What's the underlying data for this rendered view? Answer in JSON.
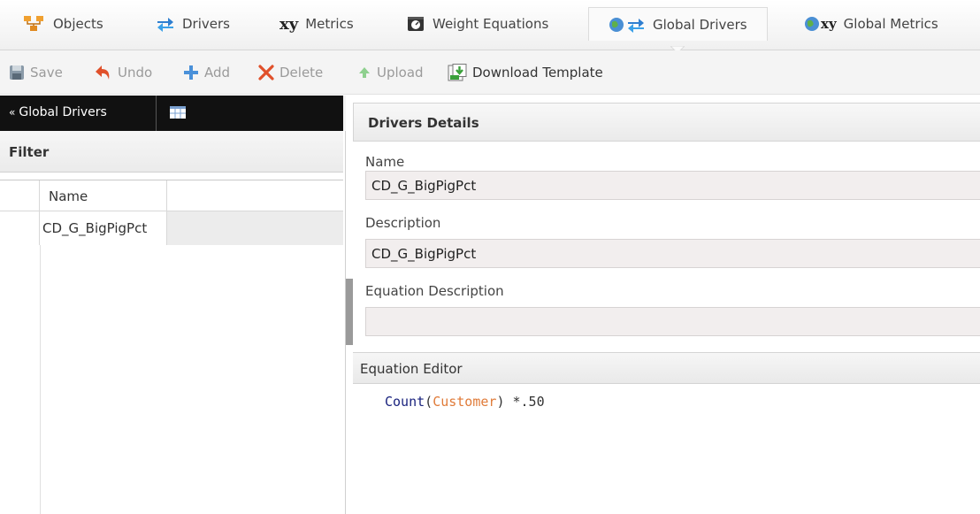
{
  "tabs": [
    {
      "label": "Objects",
      "icon": "objects-icon"
    },
    {
      "label": "Drivers",
      "icon": "drivers-icon"
    },
    {
      "label": "Metrics",
      "icon": "xy-metrics-icon",
      "icon_text": "xy"
    },
    {
      "label": "Weight Equations",
      "icon": "scale-icon"
    },
    {
      "label": "Global Drivers",
      "icon": "globe-drivers-icon",
      "active": true
    },
    {
      "label": "Global Metrics",
      "icon": "globe-xy-icon",
      "icon_text": "xy"
    }
  ],
  "toolbar": {
    "save": "Save",
    "undo": "Undo",
    "add": "Add",
    "delete": "Delete",
    "upload": "Upload",
    "download": "Download Template"
  },
  "left_panel": {
    "title": "Global Drivers",
    "filter_label": "Filter",
    "grid": {
      "columns": [
        "Name"
      ],
      "rows": [
        [
          "CD_G_BigPigPct"
        ]
      ]
    }
  },
  "details": {
    "header": "Drivers Details",
    "name_label": "Name",
    "name_value": "CD_G_BigPigPct",
    "description_label": "Description",
    "description_value": "CD_G_BigPigPct",
    "equation_description_label": "Equation Description",
    "equation_description_value": ""
  },
  "equation_editor": {
    "header": "Equation Editor",
    "function": "Count",
    "open_paren": "(",
    "argument": "Customer",
    "close_paren": ")",
    "operator": " *",
    "number": ".50"
  },
  "colors": {
    "tab_active_bg": "#fafafa",
    "left_header_bg": "#111111",
    "field_bg": "#f2eeee",
    "code_function": "#1a237e",
    "code_argument": "#e07b39",
    "delete_icon": "#e0502a",
    "add_icon": "#4a90d9"
  }
}
